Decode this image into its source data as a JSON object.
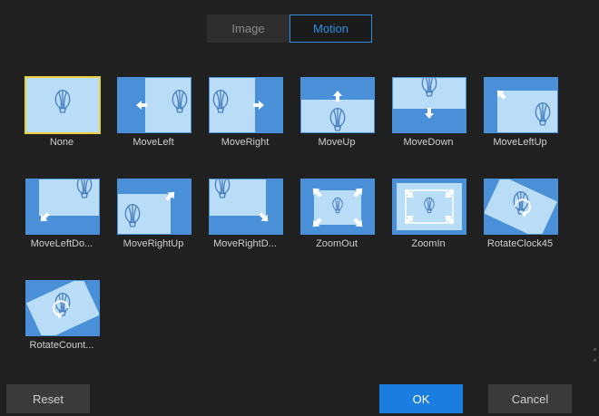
{
  "tabs": {
    "image": "Image",
    "motion": "Motion",
    "active": "Motion"
  },
  "motions": [
    {
      "label": "None",
      "kind": "none",
      "selected": true
    },
    {
      "label": "MoveLeft",
      "kind": "left"
    },
    {
      "label": "MoveRight",
      "kind": "right"
    },
    {
      "label": "MoveUp",
      "kind": "up"
    },
    {
      "label": "MoveDown",
      "kind": "down"
    },
    {
      "label": "MoveLeftUp",
      "kind": "leftup"
    },
    {
      "label": "MoveLeftDo...",
      "kind": "leftdown"
    },
    {
      "label": "MoveRightUp",
      "kind": "rightup"
    },
    {
      "label": "MoveRightD...",
      "kind": "rightdown"
    },
    {
      "label": "ZoomOut",
      "kind": "zoomout"
    },
    {
      "label": "ZoomIn",
      "kind": "zoomin"
    },
    {
      "label": "RotateClock45",
      "kind": "rotcw"
    },
    {
      "label": "RotateCount...",
      "kind": "rotccw"
    }
  ],
  "buttons": {
    "reset": "Reset",
    "ok": "OK",
    "cancel": "Cancel"
  },
  "colors": {
    "accent": "#1a7de0",
    "thumb_dark": "#4a90d9",
    "thumb_light": "#b9dcf7",
    "selected_border": "#e8d23a"
  }
}
